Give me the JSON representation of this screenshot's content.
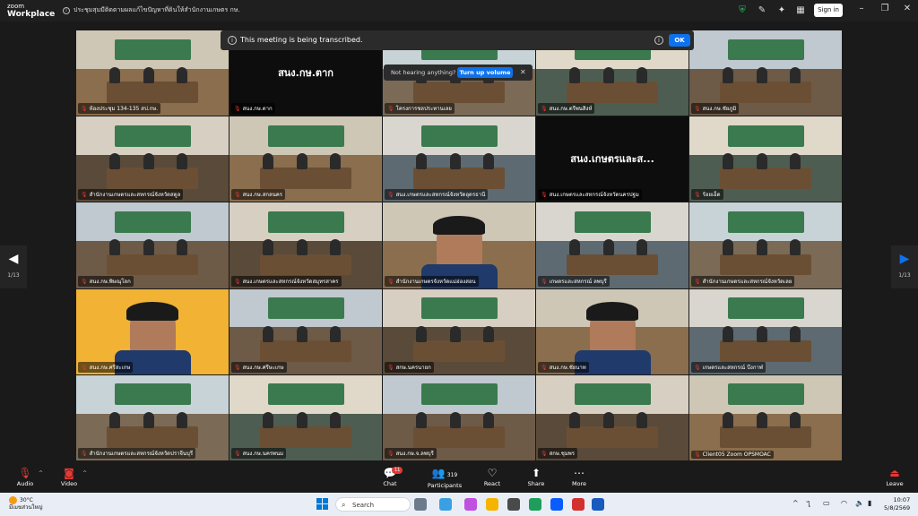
{
  "app": {
    "brand_line1": "zoom",
    "brand_line2": "Workplace",
    "meeting_title": "ประชุมสุมมีติดตามผลแก้ไขปัญหาที่ดินให้สำนักงานเกษตร กษ.",
    "sign_in": "Sign in"
  },
  "banners": {
    "transcript_text": "This meeting is being transcribed.",
    "ok_label": "OK",
    "hearing_text": "Not hearing anything?",
    "turn_up_label": "Turn up volume"
  },
  "pager": {
    "left_count": "1/13",
    "right_count": "1/13"
  },
  "tiles": [
    {
      "name": "ห้องประชุม 134-135 สป.กษ.",
      "theme": "room",
      "active": true
    },
    {
      "name": "สนง.กษ.ตาก",
      "theme": "black",
      "big": "สนง.กษ.ตาก"
    },
    {
      "name": "โครงการชลประทานเลย",
      "theme": "room"
    },
    {
      "name": "สนง.กษ.ตรีพนสิงห์",
      "theme": "room"
    },
    {
      "name": "สนง.กษ.ชัยภูมิ",
      "theme": "room"
    },
    {
      "name": "สำนักงานเกษตรและสหกรณ์จังหวัดสตูล",
      "theme": "room"
    },
    {
      "name": "สนง.กษ.สกลนคร",
      "theme": "room"
    },
    {
      "name": "สนง.เกษตรและสหกรณ์จังหวัดอุดรธานี",
      "theme": "room"
    },
    {
      "name": "สนง.เกษตรและสหกรณ์จังหวัดนครปฐม",
      "theme": "black",
      "big": "สนง.เกษตรและส..."
    },
    {
      "name": "ร้อยเอ็ด",
      "theme": "room"
    },
    {
      "name": "สนง.กษ.พิษณุโลก",
      "theme": "room"
    },
    {
      "name": "สนง.เกษตรและสหกรณ์จังหวัดสมุทรสาคร",
      "theme": "room"
    },
    {
      "name": "สำนักงานเกษตรจังหวัดแม่ฮ่องสอน",
      "theme": "face"
    },
    {
      "name": "เกษตรและสหกรณ์ ลพบุรี",
      "theme": "room"
    },
    {
      "name": "สำนักงานเกษตรและสหกรณ์จังหวัดเลย",
      "theme": "room"
    },
    {
      "name": "สนง.กษ.ศรีสะเกษ",
      "theme": "poster"
    },
    {
      "name": "สนง.กษ.ศรีษะเกษ",
      "theme": "room"
    },
    {
      "name": "สกษ.นครนายก",
      "theme": "room"
    },
    {
      "name": "สนง.กษ.ชัยนาท",
      "theme": "face2"
    },
    {
      "name": "เกษตรและสหกรณ์ บึงกาฬ",
      "theme": "room"
    },
    {
      "name": "สำนักงานเกษตรและสหกรณ์จังหวัดปราจีนบุรี",
      "theme": "room"
    },
    {
      "name": "สนง.กษ.นครพนม",
      "theme": "room"
    },
    {
      "name": "สนง.กษ.จ.ลพบุรี",
      "theme": "room"
    },
    {
      "name": "สกษ.ชุมพร",
      "theme": "room"
    },
    {
      "name": "Client05 Zoom OPSMOAC",
      "theme": "room"
    }
  ],
  "toolbar": {
    "audio": "Audio",
    "video": "Video",
    "chat": "Chat",
    "chat_badge": "11",
    "participants": "Participants",
    "participants_count": "319",
    "react": "React",
    "share": "Share",
    "more": "More",
    "leave": "Leave"
  },
  "taskbar": {
    "temp": "30°C",
    "weather_text": "มีเมฆส่วนใหญ่",
    "search": "Search",
    "time": "10:07",
    "date": "5/8/2569"
  },
  "colors": {
    "accent": "#0e72ed",
    "active_speaker": "#22c55e",
    "leave": "#e53935"
  }
}
